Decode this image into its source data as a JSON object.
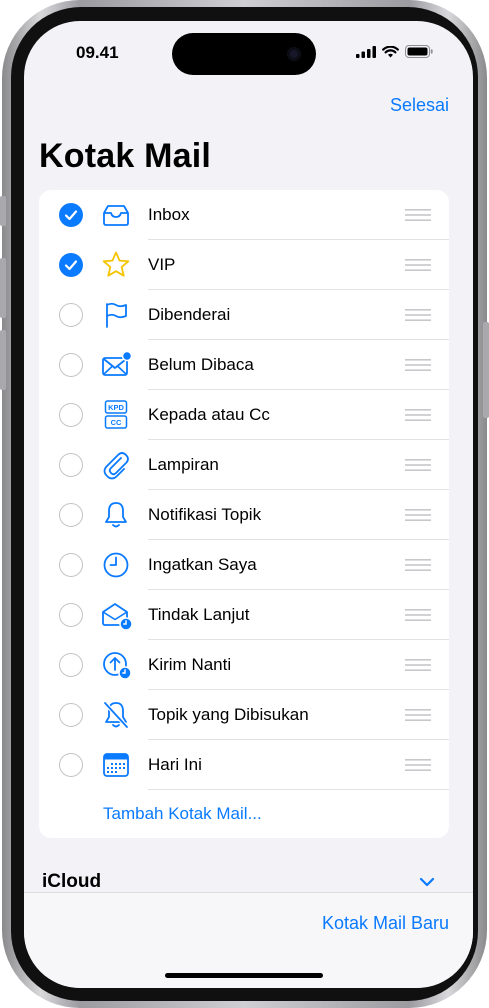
{
  "status_bar": {
    "time": "09.41"
  },
  "nav": {
    "done_label": "Selesai",
    "title": "Kotak Mail"
  },
  "mailboxes": [
    {
      "label": "Inbox",
      "checked": true,
      "icon": "inbox-tray-icon"
    },
    {
      "label": "VIP",
      "checked": true,
      "icon": "star-icon"
    },
    {
      "label": "Dibenderai",
      "checked": false,
      "icon": "flag-icon"
    },
    {
      "label": "Belum Dibaca",
      "checked": false,
      "icon": "unread-envelope-icon"
    },
    {
      "label": "Kepada atau Cc",
      "checked": false,
      "icon": "to-cc-icon",
      "icon_text": [
        "KPD",
        "CC"
      ]
    },
    {
      "label": "Lampiran",
      "checked": false,
      "icon": "paperclip-icon"
    },
    {
      "label": "Notifikasi Topik",
      "checked": false,
      "icon": "bell-icon"
    },
    {
      "label": "Ingatkan Saya",
      "checked": false,
      "icon": "clock-icon"
    },
    {
      "label": "Tindak Lanjut",
      "checked": false,
      "icon": "envelope-follow-up-icon"
    },
    {
      "label": "Kirim Nanti",
      "checked": false,
      "icon": "send-later-icon"
    },
    {
      "label": "Topik yang Dibisukan",
      "checked": false,
      "icon": "muted-bell-icon"
    },
    {
      "label": "Hari Ini",
      "checked": false,
      "icon": "calendar-icon"
    }
  ],
  "add_mailbox_label": "Tambah Kotak Mail...",
  "account": {
    "name": "iCloud"
  },
  "toolbar": {
    "new_mailbox_label": "Kotak Mail Baru"
  },
  "colors": {
    "accent": "#0a7aff",
    "star": "#f5c400",
    "background": "#f2f2f7"
  }
}
